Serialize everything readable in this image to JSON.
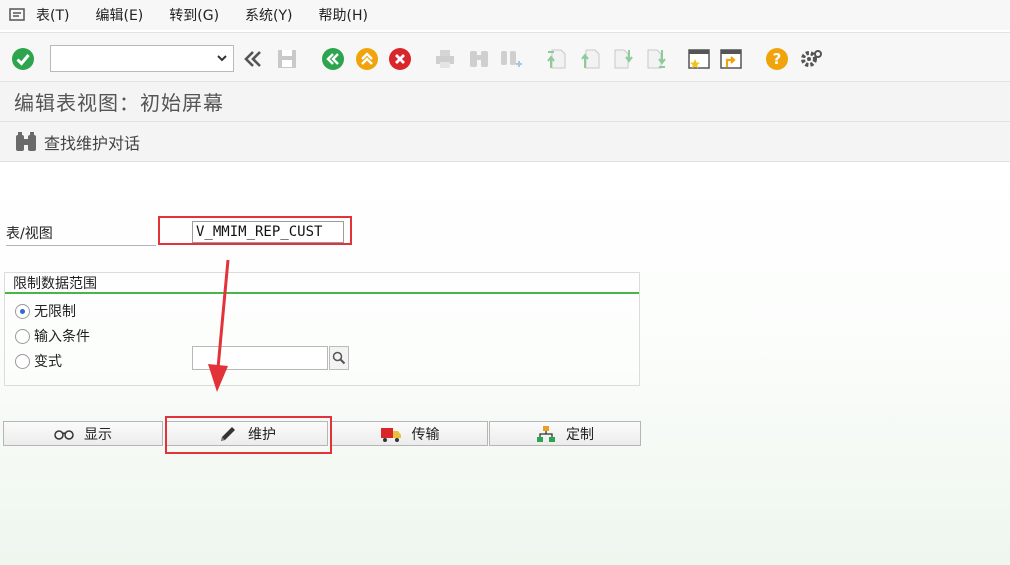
{
  "menu": [
    "表(T)",
    "编辑(E)",
    "转到(G)",
    "系统(Y)",
    "帮助(H)"
  ],
  "title": "编辑表视图：初始屏幕",
  "app_toolbar": {
    "find_label": "查找维护对话"
  },
  "form": {
    "table_label": "表/视图",
    "table_value": "V_MMIM_REP_CUST",
    "group_title": "限制数据范围",
    "radios": [
      "无限制",
      "输入条件",
      "变式"
    ],
    "selected_radio": "无限制",
    "variant_value": ""
  },
  "buttons": [
    "显示",
    "维护",
    "传输",
    "定制"
  ],
  "colors": {
    "accent_green": "#46b646",
    "annotation_red": "#e2333b",
    "ok_green": "#2da44e",
    "cancel_red": "#d9262b",
    "help_orange": "#f0a30a"
  },
  "icons": {
    "toolbar": [
      "enter-icon",
      "command-dropdown-icon",
      "double-left-icon",
      "save-icon",
      "back-icon",
      "exit-icon",
      "cancel-icon",
      "print-icon",
      "find-icon",
      "find-next-icon",
      "first-page-icon",
      "prev-page-icon",
      "next-page-icon",
      "last-page-icon",
      "new-session-icon",
      "shortcut-icon",
      "help-icon",
      "settings-icon"
    ],
    "buttons": [
      "glasses-icon",
      "pencil-icon",
      "truck-icon",
      "hierarchy-icon"
    ]
  }
}
